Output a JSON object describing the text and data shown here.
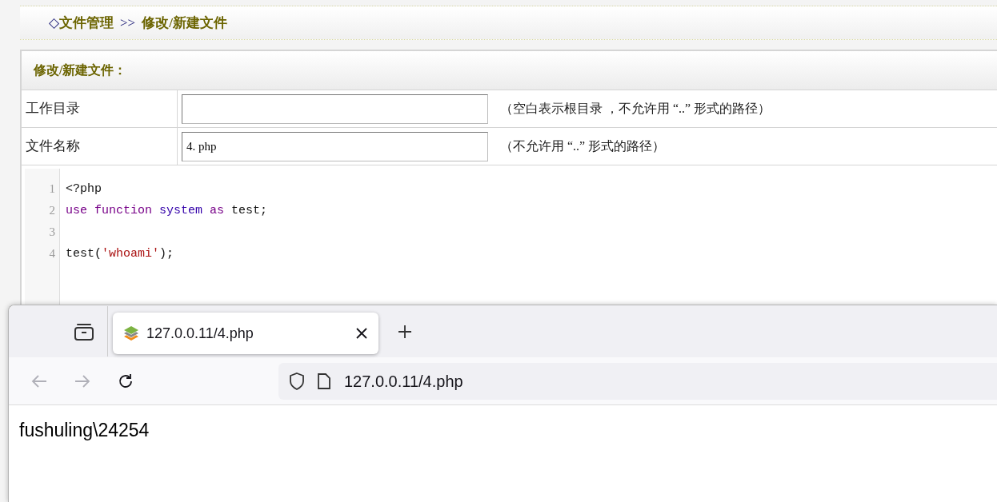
{
  "breadcrumb": {
    "icon": "◇",
    "items": [
      "文件管理",
      "修改/新建文件"
    ],
    "separator": ">>"
  },
  "panel": {
    "title": "修改/新建文件：",
    "fields": [
      {
        "label": "工作目录",
        "hint": "（空白表示根目录 ，不允许用 “..” 形式的路径）"
      },
      {
        "label": "文件名称",
        "value": "4. php",
        "hint": "（不允许用 “..” 形式的路径）"
      }
    ]
  },
  "editor": {
    "lines": [
      {
        "number": "1",
        "tokens": [
          {
            "text": "<?php",
            "kind": "plain"
          }
        ]
      },
      {
        "number": "2",
        "tokens": [
          {
            "text": "use function ",
            "kind": "keyword"
          },
          {
            "text": "system ",
            "kind": "builtin"
          },
          {
            "text": "as",
            "kind": "keyword"
          },
          {
            "text": " test;",
            "kind": "plain"
          }
        ]
      },
      {
        "number": "3"
      },
      {
        "number": "4",
        "tokens": [
          {
            "text": "test(",
            "kind": "plain"
          },
          {
            "text": "'whoami'",
            "kind": "string"
          },
          {
            "text": ");",
            "kind": "plain"
          }
        ]
      }
    ]
  },
  "browser": {
    "tabs": [
      {
        "title": "127.0.0.11/4.php",
        "selected": true
      }
    ],
    "nav": {
      "back_disabled": true,
      "forward_disabled": true
    },
    "url": "127.0.0.11/4.php",
    "content": "fushuling\\24254"
  }
}
